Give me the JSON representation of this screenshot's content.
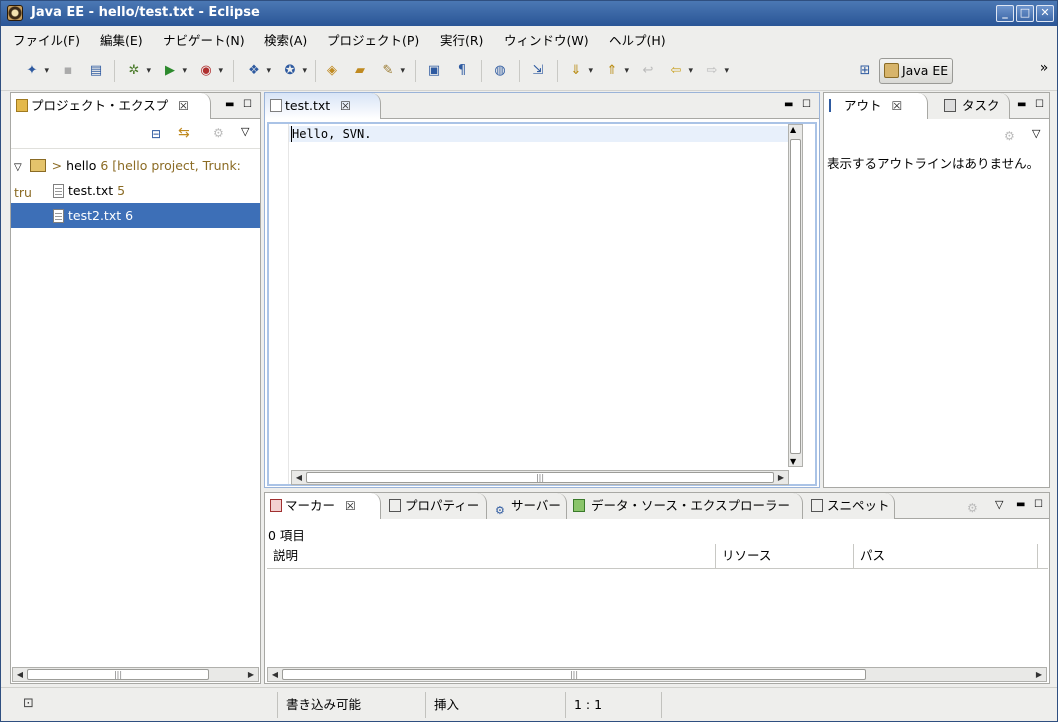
{
  "window": {
    "title": "Java EE - hello/test.txt - Eclipse"
  },
  "window_controls": {
    "minimize": "_",
    "maximize": "□",
    "close": "✕"
  },
  "menu": [
    "ファイル(F)",
    "編集(E)",
    "ナビゲート(N)",
    "検索(A)",
    "プロジェクト(P)",
    "実行(R)",
    "ウィンドウ(W)",
    "ヘルプ(H)"
  ],
  "perspective": {
    "label": "Java EE"
  },
  "toolbar_overflow": "»",
  "project_explorer": {
    "tab_label": "プロジェクト・エクスプ",
    "tree": {
      "project_name": "hello",
      "project_decoration": "6 [hello project, Trunk: tru",
      "files": [
        {
          "name": "test.txt",
          "rev": "5",
          "selected": false
        },
        {
          "name": "test2.txt",
          "rev": "6",
          "selected": true
        }
      ]
    }
  },
  "editor": {
    "tab_label": "test.txt",
    "content": "Hello, SVN."
  },
  "outline": {
    "tab_label": "アウト",
    "tab2_label": "タスク",
    "message": "表示するアウトラインはありません。"
  },
  "bottom_panel": {
    "tabs": [
      "マーカー",
      "プロパティー",
      "サーバー",
      "データ・ソース・エクスプローラー",
      "スニペット"
    ],
    "item_count": "0 項目",
    "columns": [
      "説明",
      "リソース",
      "パス"
    ]
  },
  "status_bar": {
    "writable": "書き込み可能",
    "insert_mode": "挿入",
    "position": "1 : 1"
  },
  "colors": {
    "selection": "#3d6fb7",
    "title_bar": "#2a5596",
    "decoration": "#8b6b24"
  }
}
